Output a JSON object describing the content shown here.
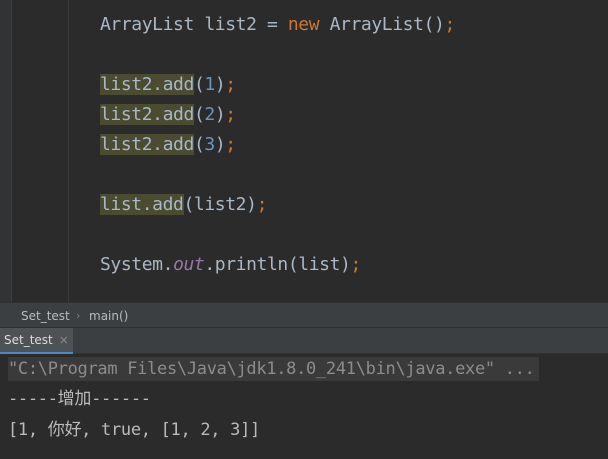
{
  "editor": {
    "lines": [
      {
        "t1": "ArrayList list2 = ",
        "kw": "new",
        "t2": " ArrayList",
        "t3": "()",
        "punc": ";"
      },
      {
        "obj": "list2.add",
        "open": "(",
        "num": "1",
        "close": ")",
        "punc": ";"
      },
      {
        "obj": "list2.add",
        "open": "(",
        "num": "2",
        "close": ")",
        "punc": ";"
      },
      {
        "obj": "list2.add",
        "open": "(",
        "num": "3",
        "close": ")",
        "punc": ";"
      },
      {
        "obj": "list.add",
        "args": "(list2)",
        "punc": ";"
      },
      {
        "cls": "System.",
        "field": "out",
        "method": ".println(list)",
        "punc": ";"
      }
    ]
  },
  "breadcrumb": {
    "items": [
      "Set_test",
      "main()"
    ],
    "separator": "›"
  },
  "run_panel": {
    "tab_label": "Set_test",
    "close_glyph": "×"
  },
  "console": {
    "lines": [
      "\"C:\\Program Files\\Java\\jdk1.8.0_241\\bin\\java.exe\" ...",
      "-----增加------",
      "[1, 你好, true, [1, 2, 3]]"
    ]
  }
}
